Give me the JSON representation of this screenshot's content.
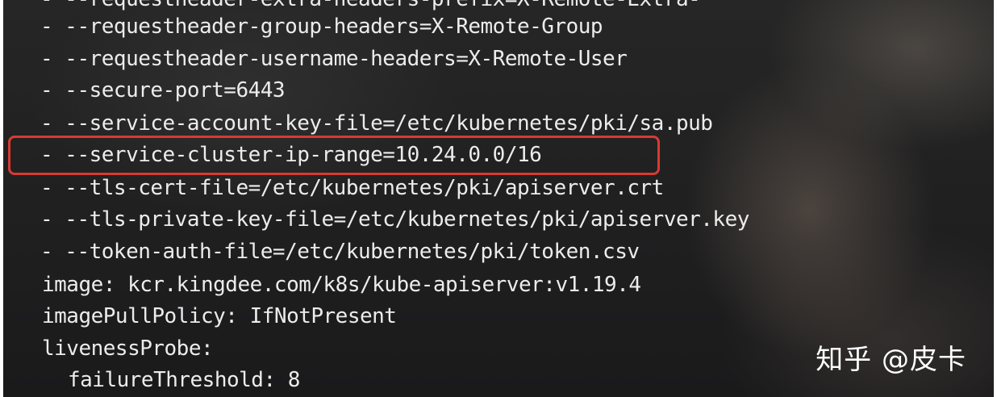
{
  "terminal": {
    "lines": [
      "- --requestheader-extra-headers-prefix=X-Remote-Extra-",
      "- --requestheader-group-headers=X-Remote-Group",
      "- --requestheader-username-headers=X-Remote-User",
      "- --secure-port=6443",
      "- --service-account-key-file=/etc/kubernetes/pki/sa.pub",
      "- --service-cluster-ip-range=10.24.0.0/16",
      "- --tls-cert-file=/etc/kubernetes/pki/apiserver.crt",
      "- --tls-private-key-file=/etc/kubernetes/pki/apiserver.key",
      "- --token-auth-file=/etc/kubernetes/pki/token.csv",
      "image: kcr.kingdee.com/k8s/kube-apiserver:v1.19.4",
      "imagePullPolicy: IfNotPresent",
      "livenessProbe:",
      "failureThreshold: 8"
    ],
    "highlight_color": "#d83a33"
  },
  "watermark": "知乎 @皮卡"
}
